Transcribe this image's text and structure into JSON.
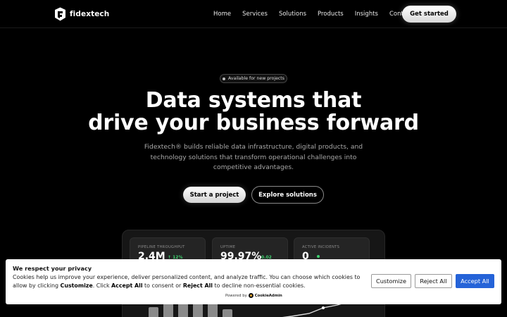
{
  "nav": {
    "brand": "fidextech",
    "links": [
      "Home",
      "Services",
      "Solutions",
      "Products",
      "Insights",
      "Contact"
    ],
    "cta": "Get started"
  },
  "hero": {
    "badge": "Available for new projects",
    "title_line1": "Data systems that",
    "title_line2": "drive your business forward",
    "subtitle": "Fidextech® builds reliable data infrastructure, digital products, and technology solutions that transform operational challenges into competitive advantages.",
    "primary_cta": "Start a project",
    "secondary_cta": "Explore solutions"
  },
  "dashboard": {
    "stats": [
      {
        "label": "PIPELINE THROUGHPUT",
        "value": "2.4M",
        "delta": "↑ 12%"
      },
      {
        "label": "UPTIME",
        "value": "99.97%",
        "delta": "0.02"
      },
      {
        "label": "ACTIVE INCIDENTS",
        "value": "0",
        "delta": ""
      }
    ],
    "bar_levels": [
      0.2,
      0.45,
      0.55,
      0.65,
      0.75,
      0.55,
      0.4
    ]
  },
  "cookie": {
    "title": "We respect your privacy",
    "text_intro": "Cookies help us improve your experience, deliver personalized content, and analyze traffic. You can choose which cookies to allow by clicking ",
    "kw_customize": "Customize",
    "text_mid1": ". Click ",
    "kw_accept": "Accept All",
    "text_mid2": " to consent or ",
    "kw_reject": "Reject All",
    "text_end": " to decline non-essential cookies.",
    "powered_by": "Powered by",
    "powered_brand": "CookieAdmin",
    "btn_customize": "Customize",
    "btn_reject": "Reject All",
    "btn_accept": "Accept All"
  },
  "colors": {
    "accent_blue": "#2563d8",
    "positive_green": "#3ecf6e",
    "background": "#000000"
  }
}
